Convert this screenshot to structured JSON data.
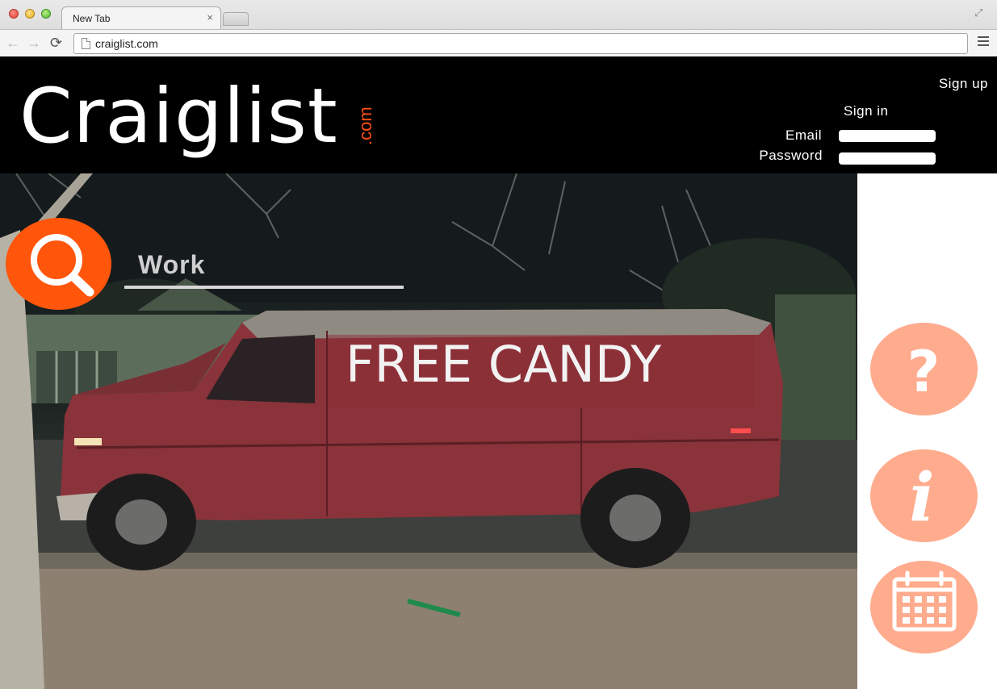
{
  "browser": {
    "tab_title": "New Tab",
    "tab_close": "×",
    "url": "craiglist.com",
    "back": "←",
    "forward": "→",
    "reload": "⟳",
    "fullscreen": "⤢"
  },
  "header": {
    "logo": "Craiglist",
    "logo_suffix": ".com",
    "sign_up": "Sign up",
    "sign_in": "Sign in",
    "email_label": "Email",
    "password_label": "Password",
    "email_value": "",
    "password_value": ""
  },
  "search": {
    "icon": "search-icon",
    "value": "Work"
  },
  "hero": {
    "van_text": "FREE CANDY"
  },
  "side_buttons": [
    {
      "icon": "help-icon",
      "glyph": "?"
    },
    {
      "icon": "info-icon",
      "glyph": "i"
    },
    {
      "icon": "calendar-icon"
    }
  ],
  "colors": {
    "header_bg": "#000000",
    "accent_orange": "#ff560c",
    "side_button": "#ffab8e",
    "logo_com": "#ff4f14"
  }
}
